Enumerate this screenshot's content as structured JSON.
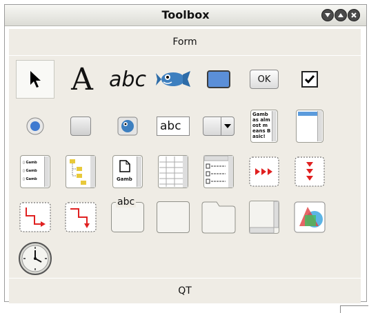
{
  "window": {
    "title": "Toolbox"
  },
  "tabs": {
    "top": "Form",
    "bottom": "QT"
  },
  "tools": [
    {
      "name": "pointer-tool",
      "icon": "arrow-pointer-icon"
    },
    {
      "name": "label-tool",
      "icon": "letter-a-icon",
      "text": "A"
    },
    {
      "name": "textlabel-tool",
      "icon": "abc-text-icon",
      "text": "abc"
    },
    {
      "name": "picturebox-tool",
      "icon": "fish-icon"
    },
    {
      "name": "panel-tool",
      "icon": "panel-icon"
    },
    {
      "name": "button-tool",
      "icon": "button-icon",
      "text": "OK"
    },
    {
      "name": "checkbox-tool",
      "icon": "checkbox-icon"
    },
    {
      "name": "radiobutton-tool",
      "icon": "radio-icon"
    },
    {
      "name": "togglebutton-tool",
      "icon": "toggle-icon"
    },
    {
      "name": "toolbutton-tool",
      "icon": "tool-button-icon"
    },
    {
      "name": "textbox-tool",
      "icon": "textbox-icon",
      "text": "abc"
    },
    {
      "name": "combobox-tool",
      "icon": "combobox-icon"
    },
    {
      "name": "textarea-tool",
      "icon": "textarea-icon",
      "text": "Gamb as alm ost m eans Basic!"
    },
    {
      "name": "listbox-tool",
      "icon": "listbox-icon"
    },
    {
      "name": "listview-tool",
      "icon": "listview-icon",
      "text": "Gamb"
    },
    {
      "name": "treeview-tool",
      "icon": "treeview-icon"
    },
    {
      "name": "iconview-tool",
      "icon": "iconview-icon",
      "text": "Gamb"
    },
    {
      "name": "gridview-tool",
      "icon": "gridview-icon"
    },
    {
      "name": "columnview-tool",
      "icon": "columnview-icon"
    },
    {
      "name": "hbox-tool",
      "icon": "hbox-icon"
    },
    {
      "name": "vbox-tool",
      "icon": "vbox-icon"
    },
    {
      "name": "hpanel-tool",
      "icon": "hpanel-icon"
    },
    {
      "name": "vpanel-tool",
      "icon": "vpanel-icon"
    },
    {
      "name": "frame-tool",
      "icon": "frame-icon",
      "text": "abc"
    },
    {
      "name": "panel-container-tool",
      "icon": "empty-panel-icon"
    },
    {
      "name": "tabstrip-tool",
      "icon": "tabstrip-icon"
    },
    {
      "name": "scrollview-tool",
      "icon": "scrollview-icon"
    },
    {
      "name": "drawingarea-tool",
      "icon": "drawingarea-icon"
    },
    {
      "name": "timer-tool",
      "icon": "clock-icon"
    }
  ],
  "colors": {
    "panel_bg": "#efece5",
    "accent_blue": "#5b8fd8",
    "red": "#e02020"
  }
}
